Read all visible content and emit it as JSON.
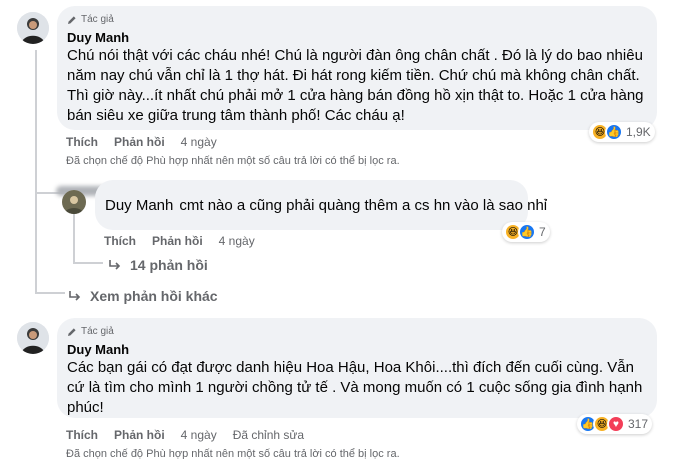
{
  "comment1": {
    "badge": "Tác giả",
    "author": "Duy Manh",
    "text": "Chú nói thật với các cháu nhé! Chú là người đàn ông chân chất . Đó là lý do bao nhiêu năm nay chú vẫn chỉ là 1 thợ hát. Đi hát rong kiếm tiền. Chứ chú mà không chân chất. Thì giờ này...ít nhất chú phải mở 1 cửa hàng bán đồng hồ xịn thật to. Hoặc 1 cửa hàng bán siêu xe giữa trung tâm thành phố! Các cháu ạ!",
    "like": "Thích",
    "reply": "Phản hồi",
    "time": "4 ngày",
    "reaction_count": "1,9K",
    "reaction_icons": [
      "haha",
      "like"
    ],
    "notice": "Đã chọn chế độ Phù hợp nhất nên một số câu trả lời có thể bị lọc ra."
  },
  "reply1": {
    "author": "Duy Manh",
    "text": "cmt nào a cũng phải quàng thêm a cs hn vào là sao nhỉ",
    "like": "Thích",
    "reply": "Phản hồi",
    "time": "4 ngày",
    "reaction_count": "7",
    "reaction_icons": [
      "haha",
      "like"
    ],
    "more_replies": "14 phản hồi"
  },
  "more_link": "Xem phản hồi khác",
  "comment2": {
    "badge": "Tác giả",
    "author": "Duy Manh",
    "text": "Các bạn gái có đạt được danh hiệu Hoa Hậu, Hoa Khôi....thì đích đến cuối cùng. Vẫn cứ là tìm cho mình 1 người chồng tử tế . Và mong muốn có 1 cuộc sống gia đình hạnh phúc!",
    "like": "Thích",
    "reply": "Phản hồi",
    "time": "4 ngày",
    "edited": "Đã chỉnh sửa",
    "reaction_count": "317",
    "reaction_icons": [
      "like",
      "haha",
      "love"
    ],
    "notice": "Đã chọn chế độ Phù hợp nhất nên một số câu trả lời có thể bị lọc ra."
  },
  "colors": {
    "bubble": "#f0f2f5",
    "secondary_text": "#65676b",
    "like_blue": "#1877f2",
    "haha_yellow": "#f7b125",
    "love_red": "#f33e58"
  }
}
